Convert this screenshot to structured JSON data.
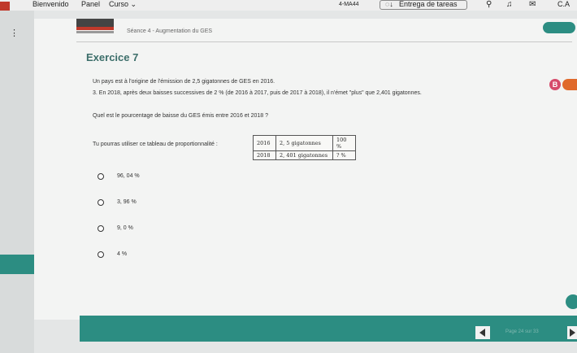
{
  "topbar": {
    "bienvenido": "Bienvenido",
    "panel": "Panel",
    "curso": "Curso",
    "code": "4-MA44",
    "tareas": "Entrega de tareas",
    "initials": "C.A"
  },
  "header": {
    "seance": "Séance 4 - Augmentation du GES"
  },
  "exercise": {
    "title": "Exercice 7",
    "p1": "Un pays est à l'origine de l'émission de 2,5 gigatonnes de GES en 2016.",
    "p2": "3. En 2018, après deux baisses successives de 2 % (de 2016 à 2017, puis de 2017 à 2018), il n'émet \"plus\" que 2,401 gigatonnes.",
    "question": "Quel est le pourcentage de baisse du GES émis entre 2016 et 2018 ?",
    "table_intro": "Tu pourras utiliser ce tableau de proportionnalité :",
    "table": [
      [
        "2016",
        "2, 5 gigatonnes",
        "100 %"
      ],
      [
        "2018",
        "2, 401 gigatonnes",
        "? %"
      ]
    ],
    "badge": "B"
  },
  "options": [
    "96, 04 %",
    "3, 96 %",
    "9, 0 %",
    "4 %"
  ],
  "footer": {
    "page_info": "Page 24 sur 33"
  },
  "colors": {
    "teal": "#2c8d82",
    "title": "#3c6e6a"
  }
}
